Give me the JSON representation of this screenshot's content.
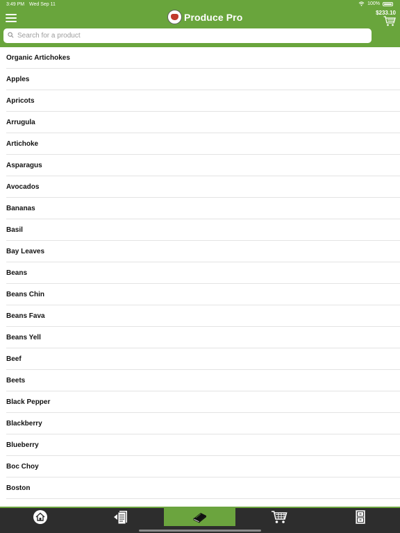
{
  "status": {
    "time": "3:49 PM",
    "date": "Wed Sep 11",
    "battery": "100%"
  },
  "header": {
    "app_title": "Produce Pro",
    "cart_total": "$233.10"
  },
  "search": {
    "placeholder": "Search for a product",
    "value": ""
  },
  "products": [
    "Organic Artichokes",
    "Apples",
    "Apricots",
    "Arrugula",
    "Artichoke",
    "Asparagus",
    "Avocados",
    "Bananas",
    "Basil",
    "Bay Leaves",
    "Beans",
    "Beans Chin",
    "Beans Fava",
    "Beans Yell",
    "Beef",
    "Beets",
    "Black Pepper",
    "Blackberry",
    "Blueberry",
    "Boc Choy",
    "Boston"
  ],
  "tabs": [
    {
      "id": "home",
      "icon": "home-icon",
      "active": false
    },
    {
      "id": "orders",
      "icon": "order-list-icon",
      "active": false
    },
    {
      "id": "catalog",
      "icon": "catalog-book-icon",
      "active": true
    },
    {
      "id": "cart",
      "icon": "cart-icon",
      "active": false
    },
    {
      "id": "more",
      "icon": "cabinet-icon",
      "active": false
    }
  ],
  "colors": {
    "brand_green": "#69a53c",
    "tab_bar": "#2d2d2d",
    "divider": "#e3e3e3"
  }
}
